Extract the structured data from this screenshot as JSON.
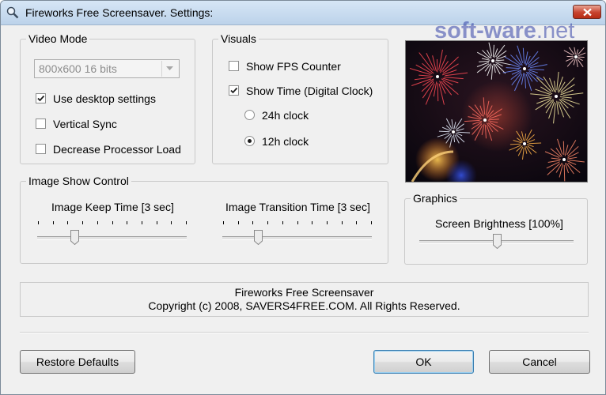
{
  "window": {
    "title": "Fireworks Free Screensaver. Settings:"
  },
  "watermark": {
    "text": "soft-ware",
    "tld": ".net",
    "color": "#3443a8"
  },
  "video_mode": {
    "legend": "Video Mode",
    "resolution": {
      "selected": "800x600 16 bits",
      "disabled": true
    },
    "options": [
      {
        "label": "Use desktop settings",
        "checked": true
      },
      {
        "label": "Vertical Sync",
        "checked": false
      },
      {
        "label": "Decrease Processor Load",
        "checked": false
      }
    ]
  },
  "visuals": {
    "legend": "Visuals",
    "show_fps": {
      "label": "Show FPS Counter",
      "checked": false
    },
    "show_time": {
      "label": "Show Time (Digital Clock)",
      "checked": true
    },
    "clock_24h": {
      "label": "24h clock",
      "selected": false
    },
    "clock_12h": {
      "label": "12h clock",
      "selected": true
    }
  },
  "image_show_control": {
    "legend": "Image Show Control",
    "keep_time": {
      "label": "Image Keep Time [3 sec]",
      "value_fraction": 0.25
    },
    "transition_time": {
      "label": "Image Transition Time [3 sec]",
      "value_fraction": 0.24
    }
  },
  "graphics": {
    "legend": "Graphics",
    "brightness": {
      "label": "Screen Brightness [100%]",
      "value_fraction": 0.5
    }
  },
  "info": {
    "line1": "Fireworks Free Screensaver",
    "line2": "Copyright (c) 2008, SAVERS4FREE.COM. All Rights Reserved."
  },
  "buttons": {
    "restore": "Restore Defaults",
    "ok": "OK",
    "cancel": "Cancel"
  },
  "colors": {
    "dialog_bg": "#f0f0f0",
    "titlebar": "#c8dcf0",
    "close_button": "#c7432e"
  }
}
